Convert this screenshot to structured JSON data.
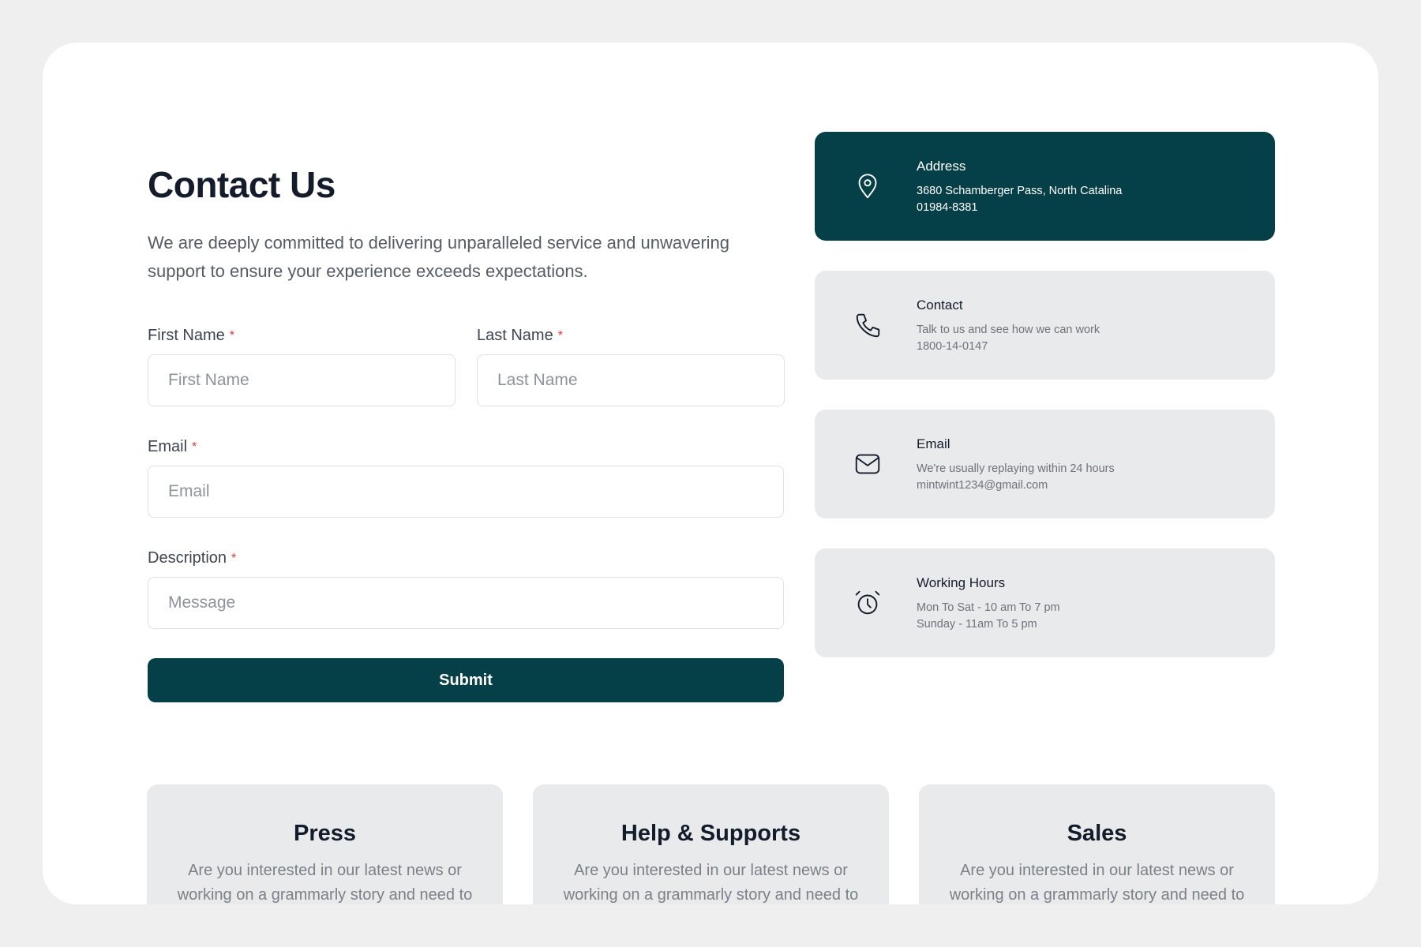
{
  "page": {
    "title": "Contact Us",
    "subtitle": "We are deeply committed to delivering unparalleled service and unwavering support to ensure your experience exceeds expectations."
  },
  "form": {
    "first_name": {
      "label": "First Name",
      "required_mark": "*",
      "placeholder": "First Name",
      "value": ""
    },
    "last_name": {
      "label": "Last Name",
      "required_mark": "*",
      "placeholder": "Last Name",
      "value": ""
    },
    "email": {
      "label": "Email",
      "required_mark": "*",
      "placeholder": "Email",
      "value": ""
    },
    "description": {
      "label": "Description",
      "required_mark": "*",
      "placeholder": "Message",
      "value": ""
    },
    "submit_label": "Submit"
  },
  "info_cards": [
    {
      "icon": "map-pin-icon",
      "title": "Address",
      "line1": "3680 Schamberger Pass, North Catalina",
      "line2": "01984-8381",
      "active": true
    },
    {
      "icon": "phone-icon",
      "title": "Contact",
      "line1": "Talk to us and see how we can work",
      "line2": "1800-14-0147",
      "active": false
    },
    {
      "icon": "mail-icon",
      "title": "Email",
      "line1": "We're usually replaying within 24 hours",
      "line2": "mintwint1234@gmail.com",
      "active": false
    },
    {
      "icon": "alarm-clock-icon",
      "title": "Working Hours",
      "line1": "Mon To Sat - 10 am To 7 pm",
      "line2": "Sunday - 11am To 5 pm",
      "active": false
    }
  ],
  "departments": [
    {
      "title": "Press",
      "text": "Are you interested in our latest news or working on a grammarly story and need to"
    },
    {
      "title": "Help & Supports",
      "text": "Are you interested in our latest news or working on a grammarly story and need to"
    },
    {
      "title": "Sales",
      "text": "Are you interested in our latest news or working on a grammarly story and need to"
    }
  ],
  "colors": {
    "accent": "#053f47",
    "card_bg": "#e8eaeb",
    "page_bg": "#efefef",
    "required": "#d93a3a"
  }
}
